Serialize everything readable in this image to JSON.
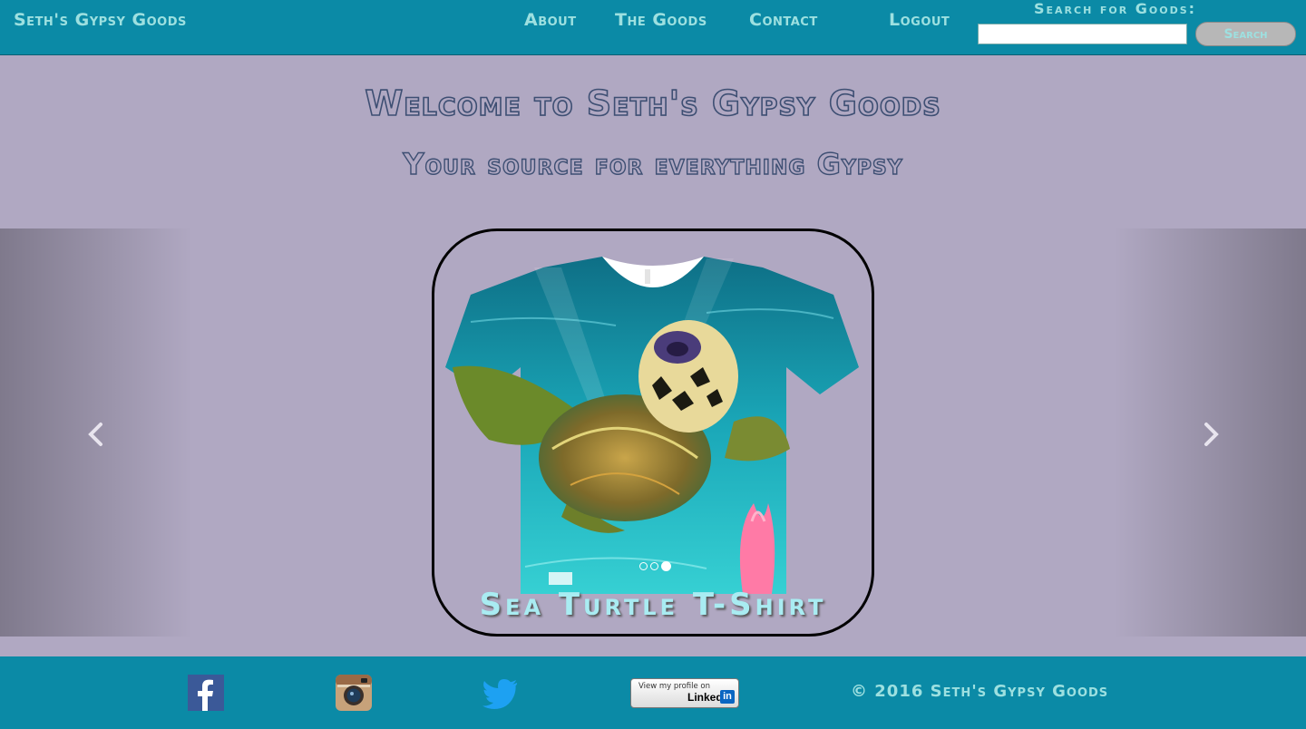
{
  "navbar": {
    "brand": "Seth's Gypsy Goods",
    "links": [
      {
        "label": "About"
      },
      {
        "label": "The Goods"
      },
      {
        "label": "Contact"
      },
      {
        "label": "Logout"
      }
    ],
    "search_label": "Search for Goods:",
    "search_value": "",
    "search_button": "Search"
  },
  "hero": {
    "title": "Welcome to Seth's Gypsy Goods",
    "subtitle": "Your source for everything Gypsy"
  },
  "carousel": {
    "slides": 3,
    "active_index": 2,
    "caption": "Sea Turtle T-Shirt",
    "prev_icon": "chevron-left-icon",
    "next_icon": "chevron-right-icon"
  },
  "footer": {
    "icons": [
      "facebook-icon",
      "instagram-icon",
      "twitter-icon"
    ],
    "linkedin_small": "View my profile on",
    "linkedin_big": "Linked",
    "linkedin_in": "in",
    "copyright": "© 2016 Seth's Gypsy Goods"
  },
  "colors": {
    "navbar": "#0b8aa6",
    "page_background": "#b0a8c2",
    "nav_text": "#9de0e0",
    "heading_outline": "#3e4f73"
  }
}
